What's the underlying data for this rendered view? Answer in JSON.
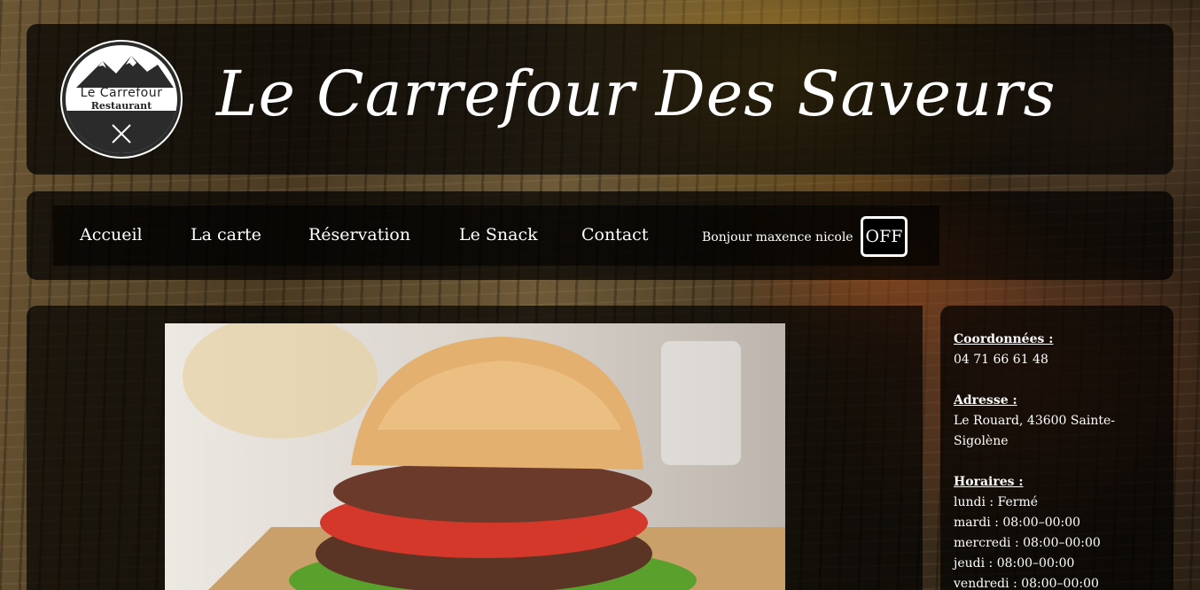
{
  "header": {
    "title": "Le Carrefour Des Saveurs",
    "logo": {
      "brand": "Le Carrefour",
      "sub": "Restaurant"
    }
  },
  "nav": {
    "items": [
      {
        "label": "Accueil"
      },
      {
        "label": "La carte"
      },
      {
        "label": "Réservation"
      },
      {
        "label": "Le Snack"
      },
      {
        "label": "Contact"
      }
    ],
    "greeting": "Bonjour maxence nicole",
    "off_label": "OFF"
  },
  "sidebar": {
    "coords_label": "Coordonnées :",
    "phone": "04 71 66 61 48",
    "address_label": "Adresse :",
    "address": "Le Rouard, 43600 Sainte-Sigolène",
    "hours_label": "Horaires :",
    "hours": [
      "lundi : Fermé",
      "mardi : 08:00–00:00",
      "mercredi : 08:00–00:00",
      "jeudi : 08:00–00:00",
      "vendredi : 08:00–00:00"
    ]
  },
  "colors": {
    "panel": "#000000",
    "text": "#ffffff",
    "wood": "#4a3a22"
  },
  "icons": {
    "logo_mountains": "mountain-icon",
    "logo_utensils": "crossed-utensils-icon"
  }
}
